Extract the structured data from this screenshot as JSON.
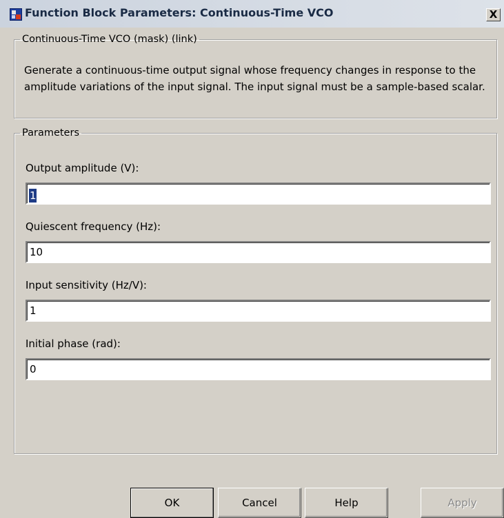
{
  "window": {
    "title": "Function Block Parameters: Continuous-Time VCO",
    "close_label": "X"
  },
  "description_group": {
    "legend": "Continuous-Time VCO (mask) (link)",
    "text": "Generate a continuous-time output signal whose frequency changes in response to the amplitude variations of the input signal. The input signal must be a sample-based scalar."
  },
  "parameters_group": {
    "legend": "Parameters",
    "fields": [
      {
        "label": "Output amplitude (V):",
        "value": "1"
      },
      {
        "label": "Quiescent frequency (Hz):",
        "value": "10"
      },
      {
        "label": "Input sensitivity (Hz/V):",
        "value": "1"
      },
      {
        "label": "Initial phase (rad):",
        "value": "0"
      }
    ]
  },
  "buttons": {
    "ok": "OK",
    "cancel": "Cancel",
    "help": "Help",
    "apply": "Apply"
  }
}
